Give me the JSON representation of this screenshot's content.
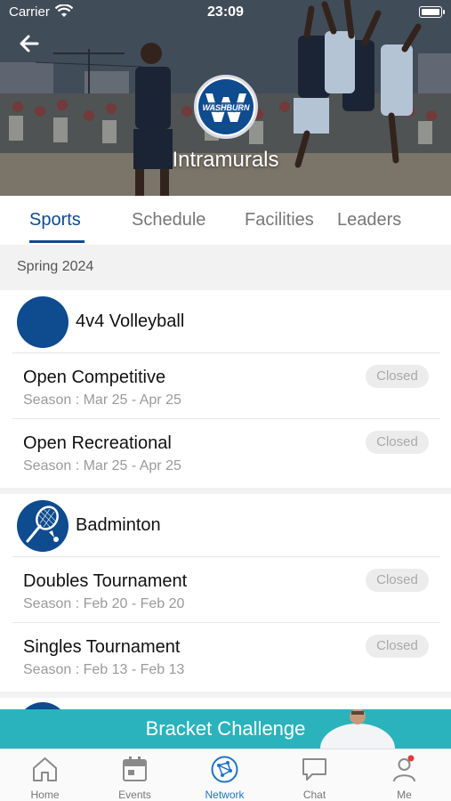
{
  "status_bar": {
    "carrier": "Carrier",
    "time": "23:09"
  },
  "header": {
    "title": "Intramurals",
    "logo_text": "WASHBURN"
  },
  "tabs": [
    {
      "label": "Sports",
      "active": true
    },
    {
      "label": "Schedule",
      "active": false
    },
    {
      "label": "Facilities",
      "active": false
    },
    {
      "label": "Leaders",
      "active": false
    }
  ],
  "season": "Spring 2024",
  "sports": [
    {
      "name": "4v4 Volleyball",
      "icon": "volleyball-icon",
      "leagues": [
        {
          "title": "Open Competitive",
          "dates": "Season : Mar 25 - Apr 25",
          "status": "Closed"
        },
        {
          "title": "Open Recreational",
          "dates": "Season : Mar 25 - Apr 25",
          "status": "Closed"
        }
      ]
    },
    {
      "name": "Badminton",
      "icon": "badminton-icon",
      "leagues": [
        {
          "title": "Doubles Tournament",
          "dates": "Season : Feb 20 - Feb 20",
          "status": "Closed"
        },
        {
          "title": "Singles Tournament",
          "dates": "Season : Feb 13 - Feb 13",
          "status": "Closed"
        }
      ]
    }
  ],
  "promo": {
    "label": "Bracket Challenge"
  },
  "tab_bar": [
    {
      "label": "Home",
      "icon": "home-icon",
      "active": false
    },
    {
      "label": "Events",
      "icon": "calendar-icon",
      "active": false
    },
    {
      "label": "Network",
      "icon": "network-icon",
      "active": true
    },
    {
      "label": "Chat",
      "icon": "chat-icon",
      "active": false
    },
    {
      "label": "Me",
      "icon": "profile-icon",
      "active": false,
      "notification_dot": true
    }
  ],
  "colors": {
    "brand": "#0e4b8f",
    "active_tab": "#1f73c5",
    "promo": "#2bb3bd",
    "badge_bg": "#ececec",
    "notification": "#e53935"
  }
}
